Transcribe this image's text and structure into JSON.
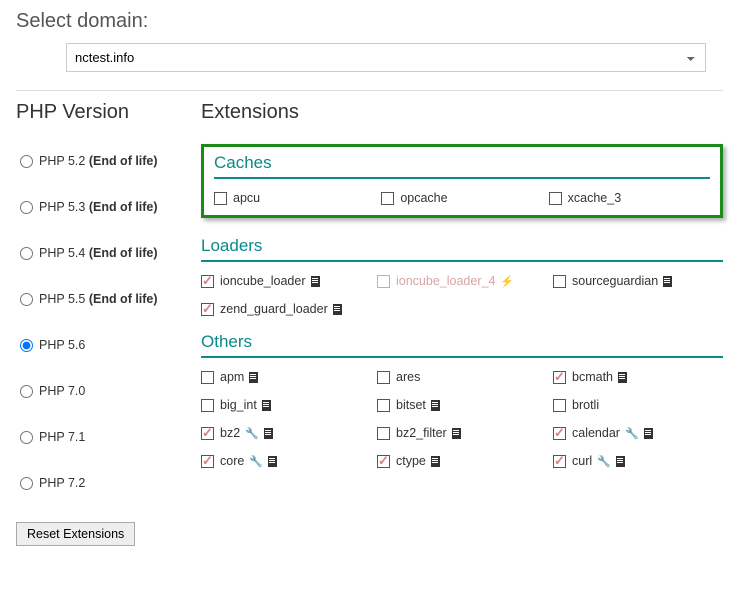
{
  "header": {
    "select_label": "Select domain:",
    "domain": "nctest.info"
  },
  "left": {
    "title": "PHP Version",
    "versions": [
      {
        "label": "PHP 5.2 ",
        "suffix": "(End of life)",
        "checked": false
      },
      {
        "label": "PHP 5.3 ",
        "suffix": "(End of life)",
        "checked": false
      },
      {
        "label": "PHP 5.4 ",
        "suffix": "(End of life)",
        "checked": false
      },
      {
        "label": "PHP 5.5 ",
        "suffix": "(End of life)",
        "checked": false
      },
      {
        "label": "PHP 5.6",
        "suffix": "",
        "checked": true
      },
      {
        "label": "PHP 7.0",
        "suffix": "",
        "checked": false
      },
      {
        "label": "PHP 7.1",
        "suffix": "",
        "checked": false
      },
      {
        "label": "PHP 7.2",
        "suffix": "",
        "checked": false
      }
    ],
    "reset": "Reset Extensions"
  },
  "right": {
    "title": "Extensions",
    "groups": {
      "caches": {
        "title": "Caches",
        "items": [
          {
            "label": "apcu",
            "checked": false
          },
          {
            "label": "opcache",
            "checked": false
          },
          {
            "label": "xcache_3",
            "checked": false
          }
        ]
      },
      "loaders": {
        "title": "Loaders",
        "items_row1": [
          {
            "label": "ioncube_loader",
            "checked": true,
            "doc": true
          },
          {
            "label": "ioncube_loader_4",
            "checked": false,
            "disabled": true,
            "bolt": true
          },
          {
            "label": "sourceguardian",
            "checked": false,
            "doc": true
          }
        ],
        "items_row2": [
          {
            "label": "zend_guard_loader",
            "checked": true,
            "doc": true
          }
        ]
      },
      "others": {
        "title": "Others",
        "rows": [
          [
            {
              "label": "apm",
              "checked": false,
              "doc": true
            },
            {
              "label": "ares",
              "checked": false
            },
            {
              "label": "bcmath",
              "checked": true,
              "doc": true
            }
          ],
          [
            {
              "label": "big_int",
              "checked": false,
              "doc": true
            },
            {
              "label": "bitset",
              "checked": false,
              "doc": true
            },
            {
              "label": "brotli",
              "checked": false
            }
          ],
          [
            {
              "label": "bz2",
              "checked": true,
              "wrench": true,
              "doc": true
            },
            {
              "label": "bz2_filter",
              "checked": false,
              "doc": true
            },
            {
              "label": "calendar",
              "checked": true,
              "wrench": true,
              "doc": true
            }
          ],
          [
            {
              "label": "core",
              "checked": true,
              "wrench": true,
              "doc": true
            },
            {
              "label": "ctype",
              "checked": true,
              "doc": true
            },
            {
              "label": "curl",
              "checked": true,
              "wrench": true,
              "doc": true
            }
          ]
        ]
      }
    }
  }
}
